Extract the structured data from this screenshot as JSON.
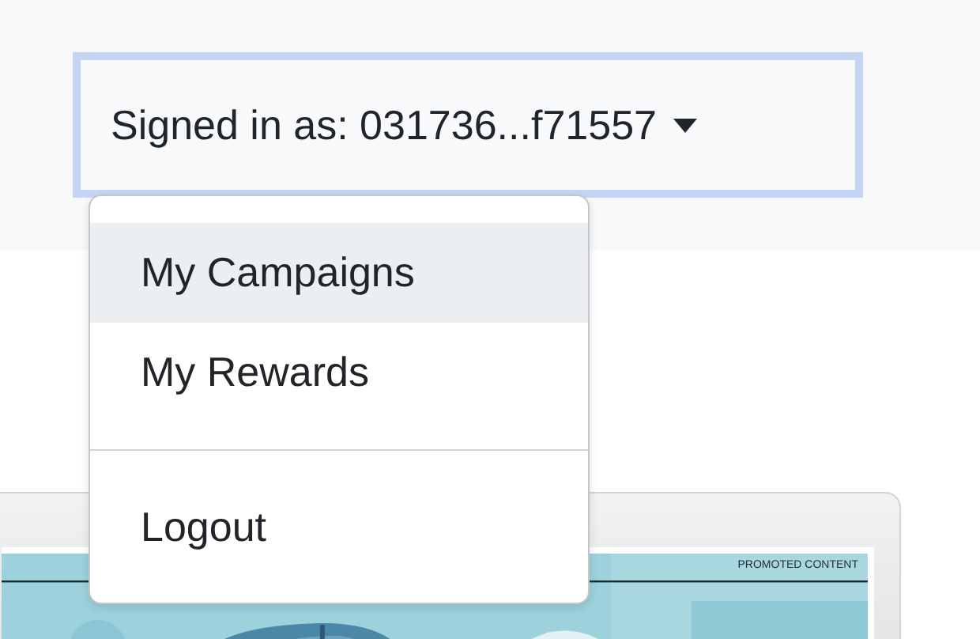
{
  "account_button": {
    "label": "Signed in as: 031736...f71557"
  },
  "account_menu": {
    "items": [
      {
        "kind": "item",
        "label": "My Campaigns",
        "selected": true
      },
      {
        "kind": "item",
        "label": "My Rewards",
        "selected": false
      },
      {
        "kind": "divider"
      },
      {
        "kind": "item",
        "label": "Logout",
        "selected": false
      }
    ]
  },
  "promo_card": {
    "label": "PROMOTED CONTENT"
  }
}
